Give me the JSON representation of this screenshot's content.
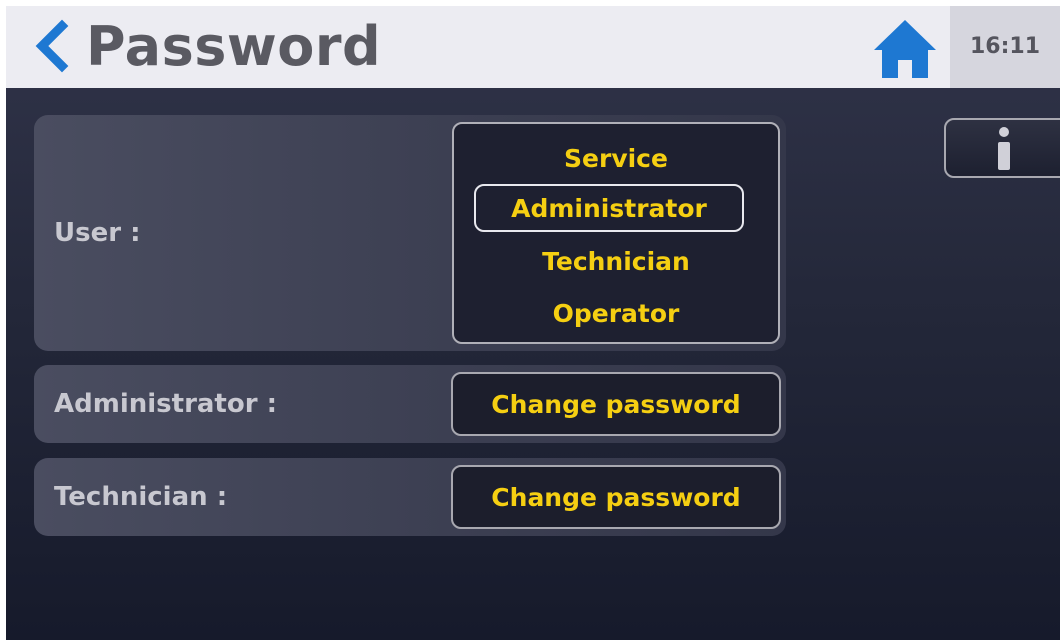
{
  "header": {
    "title": "Password",
    "time": "16:11",
    "back_icon": "chevron-left-icon",
    "home_icon": "home-icon",
    "accent_color": "#1e78d2"
  },
  "user_section": {
    "label": "User :",
    "options": [
      "Service",
      "Administrator",
      "Technician",
      "Operator"
    ],
    "selected": "Administrator"
  },
  "administrator_section": {
    "label": "Administrator :",
    "button_label": "Change password"
  },
  "technician_section": {
    "label": "Technician :",
    "button_label": "Change password"
  },
  "info_button": {
    "icon": "info-icon"
  },
  "colors": {
    "option_text": "#f5cf12",
    "header_bg": "#ececf2"
  }
}
